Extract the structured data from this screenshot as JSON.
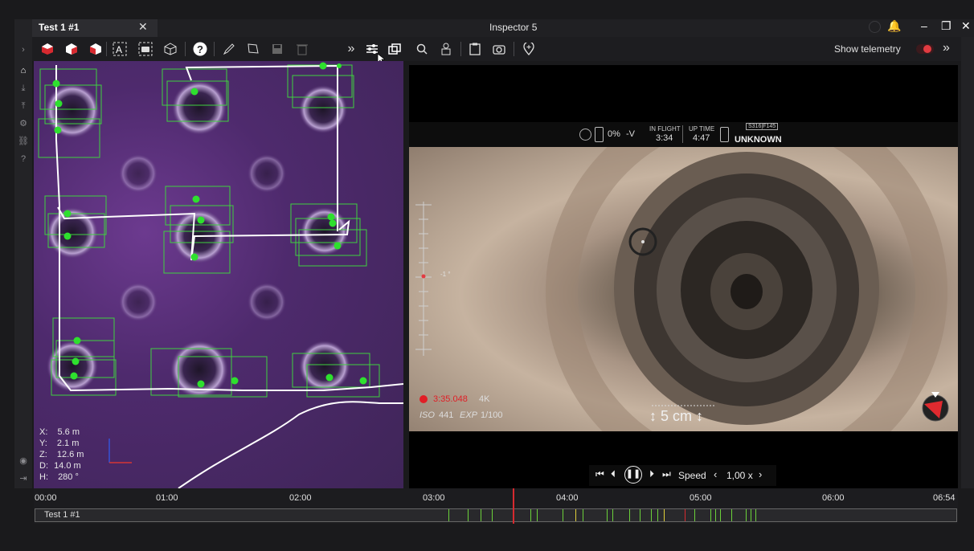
{
  "window": {
    "tab_title": "Test 1 #1",
    "tab_close": "✕",
    "app_title": "Inspector 5",
    "controls": [
      "🔔",
      "–",
      "❐",
      "✕"
    ]
  },
  "toolbar": {
    "show_telemetry_label": "Show telemetry",
    "telemetry_on": true,
    "accent_color": "#e23b41",
    "tools": [
      "cube-red-icon",
      "cube-red-icon",
      "cube-red-icon",
      "text-frame-icon",
      "camera-frame-icon",
      "wireframe-cube-icon",
      "help-icon",
      "pencil-icon",
      "polygon-icon",
      "save-icon",
      "trash-icon",
      "double-chevron-icon",
      "sliders-icon",
      "layers-icon",
      "zoom-icon",
      "robot-icon",
      "clipboard-icon",
      "camera-icon",
      "location-add-icon"
    ]
  },
  "map": {
    "coords": [
      {
        "label": "X:",
        "value": "5.6 m"
      },
      {
        "label": "Y:",
        "value": "2.1 m"
      },
      {
        "label": "Z:",
        "value": "12.6 m"
      },
      {
        "label": "D:",
        "value": "14.0 m"
      },
      {
        "label": "H:",
        "value": "280 °"
      }
    ]
  },
  "camera": {
    "battery_percent": "0%",
    "voltage_label": "-V",
    "in_flight_label": "IN FLIGHT",
    "in_flight_value": "3:34",
    "up_time_label": "UP TIME",
    "up_time_value": "4:47",
    "device_code": "S316|F145",
    "status": "UNKNOWN",
    "pitch_marker": "-1 °",
    "rec_time": "3:35.048",
    "resolution": "4K",
    "iso_label": "ISO",
    "iso_value": "441",
    "exp_label": "EXP",
    "exp_value": "1/100",
    "distance": "5 cm"
  },
  "playback": {
    "speed_label": "Speed",
    "speed_value": "1,00 x"
  },
  "timeline": {
    "ticks": [
      "00:00",
      "01:00",
      "02:00",
      "03:00",
      "04:00",
      "05:00",
      "06:00",
      "06:54"
    ],
    "track_label": "Test 1 #1",
    "playhead_color": "#d62a2f"
  }
}
